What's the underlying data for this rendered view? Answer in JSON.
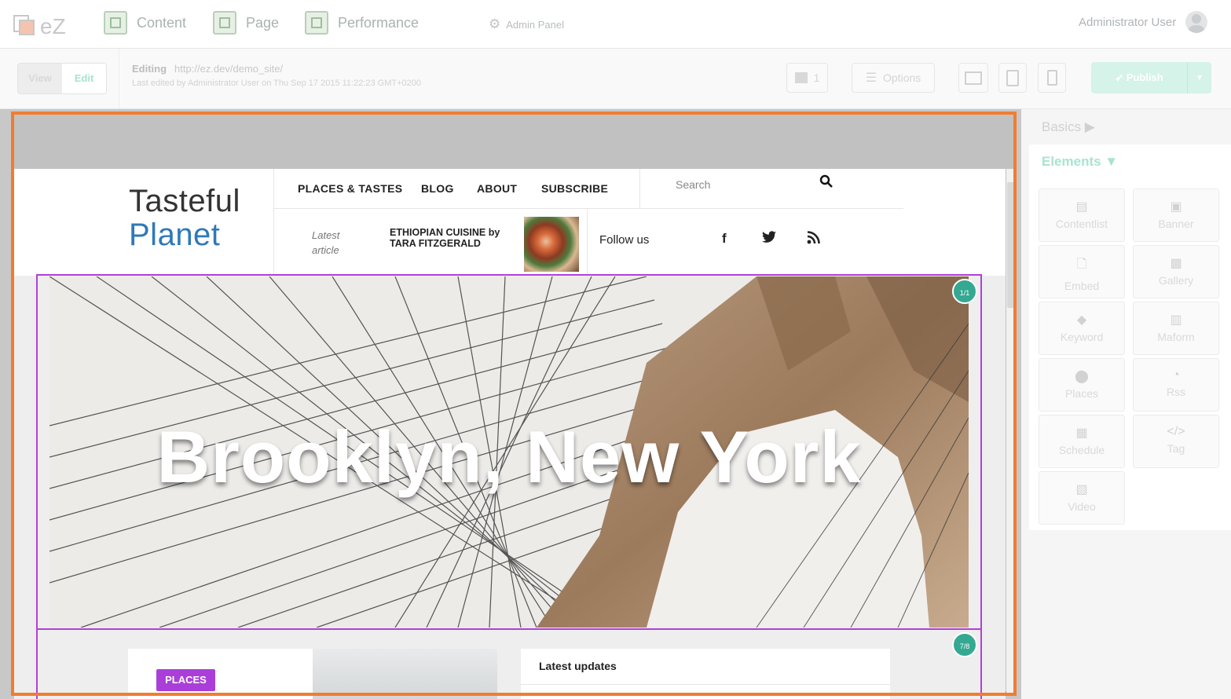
{
  "topbar": {
    "logo_text": "eZ",
    "nav": [
      {
        "label": "Content",
        "icon": "content-icon"
      },
      {
        "label": "Page",
        "icon": "page-icon"
      },
      {
        "label": "Performance",
        "icon": "performance-icon"
      }
    ],
    "admin_panel": "Admin Panel",
    "user": "Administrator User"
  },
  "toolbar": {
    "view_label": "View",
    "edit_label": "Edit",
    "editing_label": "Editing",
    "editing_url": "http://ez.dev/demo_site/",
    "last_edited": "Last edited by Administrator User on Thu Sep 17 2015 11:22:23 GMT+0200",
    "count": "1",
    "options_label": "Options",
    "publish_label": "Publish"
  },
  "panel": {
    "basics": "Basics ▶",
    "elements": "Elements ▼",
    "tiles": [
      "Contentlist",
      "Banner",
      "Embed",
      "Gallery",
      "Keyword",
      "Maform",
      "Places",
      "Rss",
      "Schedule",
      "Tag",
      "Video"
    ]
  },
  "site": {
    "brand_line1": "Tasteful",
    "brand_line2": "Planet",
    "menu": [
      "PLACES & TASTES",
      "BLOG",
      "ABOUT",
      "SUBSCRIBE"
    ],
    "search_placeholder": "Search",
    "latest_label_1": "Latest",
    "latest_label_2": "article",
    "latest_title": "ETHIOPIAN CUISINE by TARA FITZGERALD",
    "follow_us": "Follow us",
    "social": [
      "f",
      "🐦",
      "◉"
    ],
    "hero_title": "Brooklyn, New York",
    "hero_badge": "1/1",
    "block2_badge": "7/8",
    "places_tag": "PLACES",
    "latest_updates": "Latest updates"
  },
  "colors": {
    "accent": "#f07d30",
    "selection": "#b23fd8",
    "badge": "#35a892",
    "brand_blue": "#2f79b8"
  }
}
